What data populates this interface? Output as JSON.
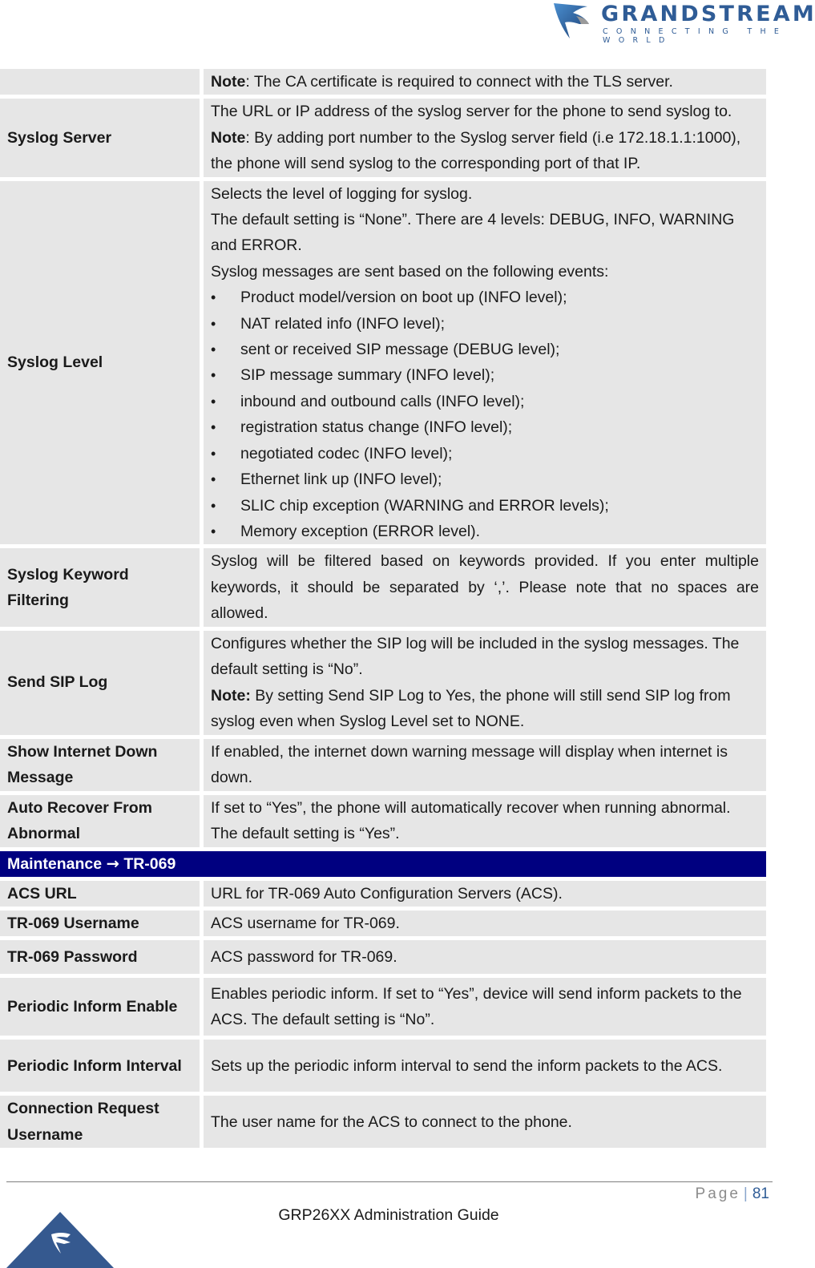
{
  "header": {
    "brand": "GRANDSTREAM",
    "tagline": "CONNECTING THE WORLD",
    "logo_icon": "grandstream-logo-icon"
  },
  "table": {
    "rows": [
      {
        "label": "",
        "paragraphs": [
          {
            "bold_prefix": "Note",
            "text": ": The CA certificate is required to connect with the TLS server."
          }
        ]
      },
      {
        "label": "Syslog Server",
        "paragraphs": [
          {
            "bold_prefix": "",
            "text": "The URL or IP address of the syslog server for the phone to send syslog to."
          },
          {
            "bold_prefix": "Note",
            "text": ": By adding port number to the Syslog server field (i.e 172.18.1.1:1000), the phone will send syslog to the corresponding port of that IP."
          }
        ]
      },
      {
        "label": "Syslog Level",
        "paragraphs": [
          {
            "bold_prefix": "",
            "text": "Selects the level of logging for syslog."
          },
          {
            "bold_prefix": "",
            "text": "The default setting is “None”. There are 4 levels: DEBUG, INFO, WARNING and ERROR."
          },
          {
            "bold_prefix": "",
            "text": "Syslog messages are sent based on the following events:"
          }
        ],
        "bullets": [
          "Product model/version on boot up (INFO level);",
          "NAT related info (INFO level);",
          "sent or received SIP message (DEBUG level);",
          "SIP message summary (INFO level);",
          "inbound and outbound calls (INFO level);",
          "registration status change (INFO level);",
          "negotiated codec (INFO level);",
          "Ethernet link up (INFO level);",
          "SLIC chip exception (WARNING and ERROR levels);",
          "Memory exception (ERROR level)."
        ]
      },
      {
        "label": "Syslog Keyword Filtering",
        "paragraphs": [
          {
            "bold_prefix": "",
            "text": "Syslog will be filtered based on keywords provided. If you enter multiple keywords, it should be separated by ‘,’. Please note that no spaces are allowed."
          }
        ]
      },
      {
        "label": "Send SIP Log",
        "paragraphs": [
          {
            "bold_prefix": "",
            "text": "Configures whether the SIP log will be included in the syslog messages. The default setting is “No”."
          },
          {
            "bold_prefix": "Note:",
            "text": " By setting Send SIP Log to Yes, the phone will still send SIP log from syslog even when Syslog Level set to NONE."
          }
        ]
      },
      {
        "label": "Show Internet Down Message",
        "paragraphs": [
          {
            "bold_prefix": "",
            "text": "If enabled, the internet down warning message will display when internet is down."
          }
        ]
      },
      {
        "label": "Auto Recover From Abnormal",
        "paragraphs": [
          {
            "bold_prefix": "",
            "text": "If set to “Yes”, the phone will automatically recover when running abnormal. The default setting is “Yes”."
          }
        ]
      }
    ],
    "section": {
      "prefix": "Maintenance",
      "arrow": "→",
      "suffix": "TR-069"
    },
    "rows2": [
      {
        "label": "ACS URL",
        "text": "URL for TR-069 Auto Configuration Servers (ACS)."
      },
      {
        "label": "TR-069 Username",
        "text": "ACS username for TR-069."
      },
      {
        "label": "TR-069 Password",
        "text": "ACS password for TR-069."
      },
      {
        "label": "Periodic Inform Enable",
        "text": "Enables periodic inform. If set to “Yes”, device will send inform packets to the ACS. The default setting is “No”."
      },
      {
        "label": "Periodic Inform Interval",
        "text": "Sets up the periodic inform interval to send the inform packets to the ACS."
      },
      {
        "label": "Connection Request Username",
        "text": "The user name for the ACS to connect to the phone."
      }
    ]
  },
  "footer": {
    "page_label": "Page",
    "separator": "|",
    "page_number": "81",
    "title": "GRP26XX Administration Guide"
  },
  "colors": {
    "section_header": "#000080",
    "cell_bg": "#e6e6e6",
    "brand_blue": "#2f5c96"
  }
}
